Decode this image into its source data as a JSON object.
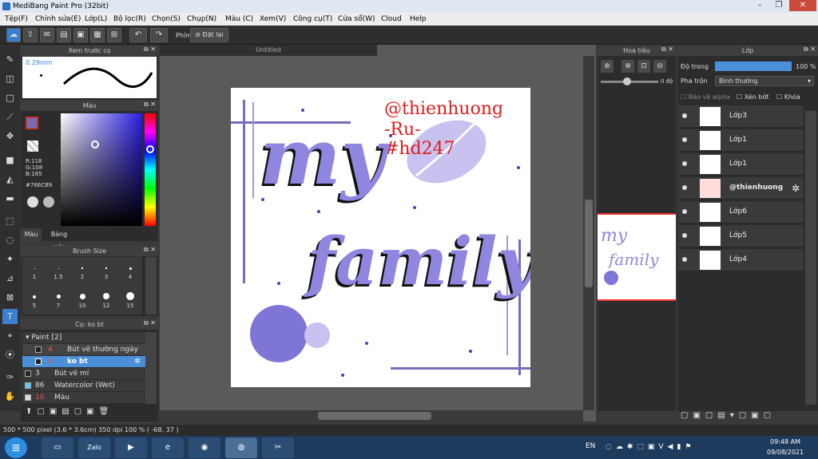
{
  "window": {
    "title": "MediBang Paint Pro (32bit)"
  },
  "menu": [
    "Tệp(F)",
    "Chỉnh sửa(E)",
    "Lớp(L)",
    "Bộ lọc(R)",
    "Chọn(S)",
    "Chụp(N)",
    "Màu (C)",
    "Xem(V)",
    "Công cụ(T)",
    "Cửa sổ(W)",
    "Cloud",
    "Help"
  ],
  "toolbar": {
    "phim_label": "Phím",
    "reset_label": "Đặt lại"
  },
  "preview": {
    "title": "Xem trước cọ",
    "size": "0.29mm"
  },
  "color": {
    "title": "Màu",
    "r": "R:118",
    "g": "G:108",
    "b": "B:185",
    "hex": "#766CB9",
    "tab1": "Màu",
    "tab2": "Bảng màu",
    "accent": "#766CB9"
  },
  "brushsize": {
    "title": "Brush Size",
    "sizes": [
      "1",
      "1.5",
      "2",
      "3",
      "4",
      "5",
      "7",
      "10",
      "12",
      "15"
    ]
  },
  "brushes": {
    "title": "Cọ: ko bt",
    "group": "Paint [2]",
    "items": [
      {
        "num": "4",
        "name": "Bút vẽ thường ngày"
      },
      {
        "num": "4",
        "name": "ko bt"
      },
      {
        "num": "3",
        "name": "Bút vẽ mí"
      },
      {
        "num": "86",
        "name": "Watercolor (Wet)"
      },
      {
        "num": "10",
        "name": "Màu"
      }
    ]
  },
  "canvas": {
    "tab": "Untitled",
    "watermark1": "@thienhuong",
    "watermark2": "-Ru-",
    "watermark3": "#hd247",
    "text1": "my",
    "text2": "family"
  },
  "navigator": {
    "title": "Hoa tiêu",
    "angle": "0 độ"
  },
  "layers": {
    "title": "Lớp",
    "opacity_label": "Độ trong",
    "opacity": "100 %",
    "blend_label": "Pha trộn",
    "blend": "Bình thường",
    "protect": "Bảo vệ alpha",
    "clip": "Xén bớt",
    "lock": "Khóa",
    "items": [
      "Lớp3",
      "Lớp1",
      "Lớp1",
      "@thienhuong",
      "Lớp6",
      "Lớp5",
      "Lớp4"
    ]
  },
  "status": {
    "text": "500 * 500 pixel  (3.6 * 3.6cm)  350 dpi  100 %  ( -68, 37 )"
  },
  "taskbar": {
    "lang": "EN",
    "time": "09:48 AM",
    "date": "09/08/2021",
    "zalo": "Zalo"
  }
}
